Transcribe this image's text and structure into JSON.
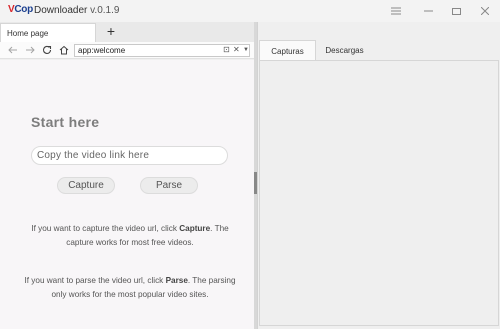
{
  "app": {
    "logo_v": "V",
    "logo_cop": "Cop",
    "name": "Downloader",
    "version": "v.0.1.9"
  },
  "window_controls": {
    "menu_icon": "hamburger-icon",
    "minimize_icon": "minimize-icon",
    "maximize_icon": "maximize-icon",
    "close_icon": "close-icon"
  },
  "browser": {
    "tab_label": "Home page",
    "add_tab_label": "+",
    "url": "app:welcome"
  },
  "welcome": {
    "heading": "Start here",
    "input_placeholder": "Copy the video link here",
    "capture_label": "Capture",
    "parse_label": "Parse",
    "capture_text_before": "If you want to capture the video url, click",
    "capture_keyword": "Capture",
    "capture_text_after": ". The capture works for most free videos.",
    "parse_text_before": "If you want to parse the video url, click",
    "parse_keyword": "Parse",
    "parse_text_after": ". The parsing only works for the most popular video sites."
  },
  "panel": {
    "tabs": [
      {
        "label": "Capturas",
        "active": true
      },
      {
        "label": "Descargas",
        "active": false
      }
    ]
  }
}
